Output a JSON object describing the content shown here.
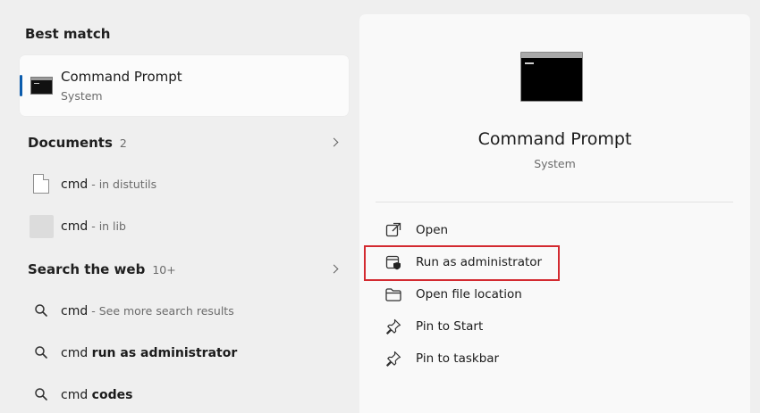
{
  "left": {
    "best_match_title": "Best match",
    "best_match": {
      "name": "Command Prompt",
      "sub": "System"
    },
    "documents": {
      "title": "Documents",
      "count": "2",
      "items": [
        {
          "name": "cmd",
          "detail": " - in distutils"
        },
        {
          "name": "cmd",
          "detail": " - in lib"
        }
      ]
    },
    "web": {
      "title": "Search the web",
      "count": "10+",
      "items": [
        {
          "prefix": "cmd",
          "muted": " - See more search results",
          "bold": ""
        },
        {
          "prefix": "cmd ",
          "muted": "",
          "bold": "run as administrator"
        },
        {
          "prefix": "cmd ",
          "muted": "",
          "bold": "codes"
        }
      ]
    }
  },
  "right": {
    "title": "Command Prompt",
    "sub": "System",
    "actions": [
      {
        "label": "Open",
        "icon": "open-external-icon"
      },
      {
        "label": "Run as administrator",
        "icon": "admin-shield-icon"
      },
      {
        "label": "Open file location",
        "icon": "folder-icon"
      },
      {
        "label": "Pin to Start",
        "icon": "pin-icon"
      },
      {
        "label": "Pin to taskbar",
        "icon": "pin-icon"
      }
    ]
  },
  "colors": {
    "accent": "#0b5cad",
    "highlight": "#d32a30"
  }
}
